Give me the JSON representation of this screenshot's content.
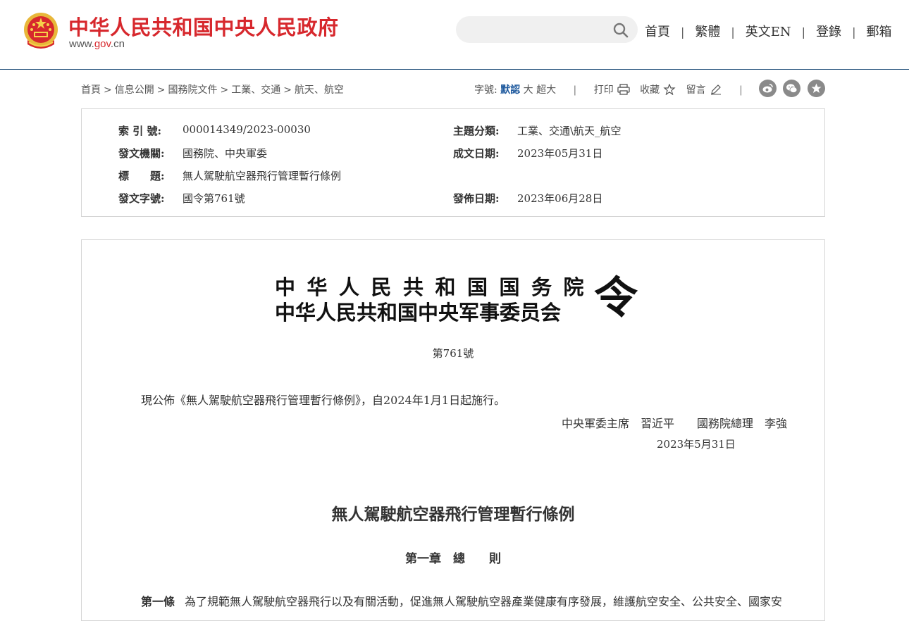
{
  "header": {
    "site_title": "中华人民共和国中央人民政府",
    "site_url_prefix": "www.",
    "site_url_brand": "gov",
    "site_url_suffix": ".cn",
    "search_placeholder": "",
    "nav": [
      "首頁",
      "繁體",
      "英文EN",
      "登錄",
      "郵箱"
    ],
    "nav_separator": "|",
    "brand_color": "#d7282d",
    "rule_color": "#1f4e79"
  },
  "breadcrumb": {
    "items": [
      "首頁",
      "信息公開",
      "國務院文件",
      "工業、交通",
      "航天、航空"
    ],
    "separator": ">"
  },
  "toolbar": {
    "font_size_label": "字號:",
    "font_sizes": [
      "默認",
      "大",
      "超大"
    ],
    "active_font_size": "默認",
    "print_label": "打印",
    "favorite_label": "收藏",
    "comment_label": "留言",
    "separator": "|",
    "share_icons": [
      "weibo-icon",
      "wechat-icon",
      "star-circle-icon"
    ]
  },
  "info": {
    "index_label": "索 引 號:",
    "index_value": "000014349/2023-00030",
    "category_label": "主題分類:",
    "category_value": "工業、交通\\航天_航空",
    "issuer_label": "發文機關:",
    "issuer_value": "國務院、中央軍委",
    "written_date_label": "成文日期:",
    "written_date_value": "2023年05月31日",
    "title_label": "標　　題:",
    "title_value": "無人駕駛航空器飛行管理暫行條例",
    "doc_number_label": "發文字號:",
    "doc_number_value": "國令第761號",
    "publish_date_label": "發佈日期:",
    "publish_date_value": "2023年06月28日"
  },
  "document": {
    "issuer_line1": "中华人民共和国国务院",
    "issuer_line2": "中华人民共和国中央军事委员会",
    "order_char": "令",
    "doc_no": "第761號",
    "announcement": "現公佈《無人駕駛航空器飛行管理暫行條例》，自2024年1月1日起施行。",
    "signers": "中央軍委主席　習近平　　國務院總理　李強",
    "sign_date": "2023年5月31日",
    "regulation_title": "無人駕駛航空器飛行管理暫行條例",
    "chapter_title": "第一章　總　　則",
    "article1_label": "第一條",
    "article1_text": "為了規範無人駕駛航空器飛行以及有關活動，促進無人駕駛航空器產業健康有序發展，維護航空安全、公共安全、國家安"
  }
}
